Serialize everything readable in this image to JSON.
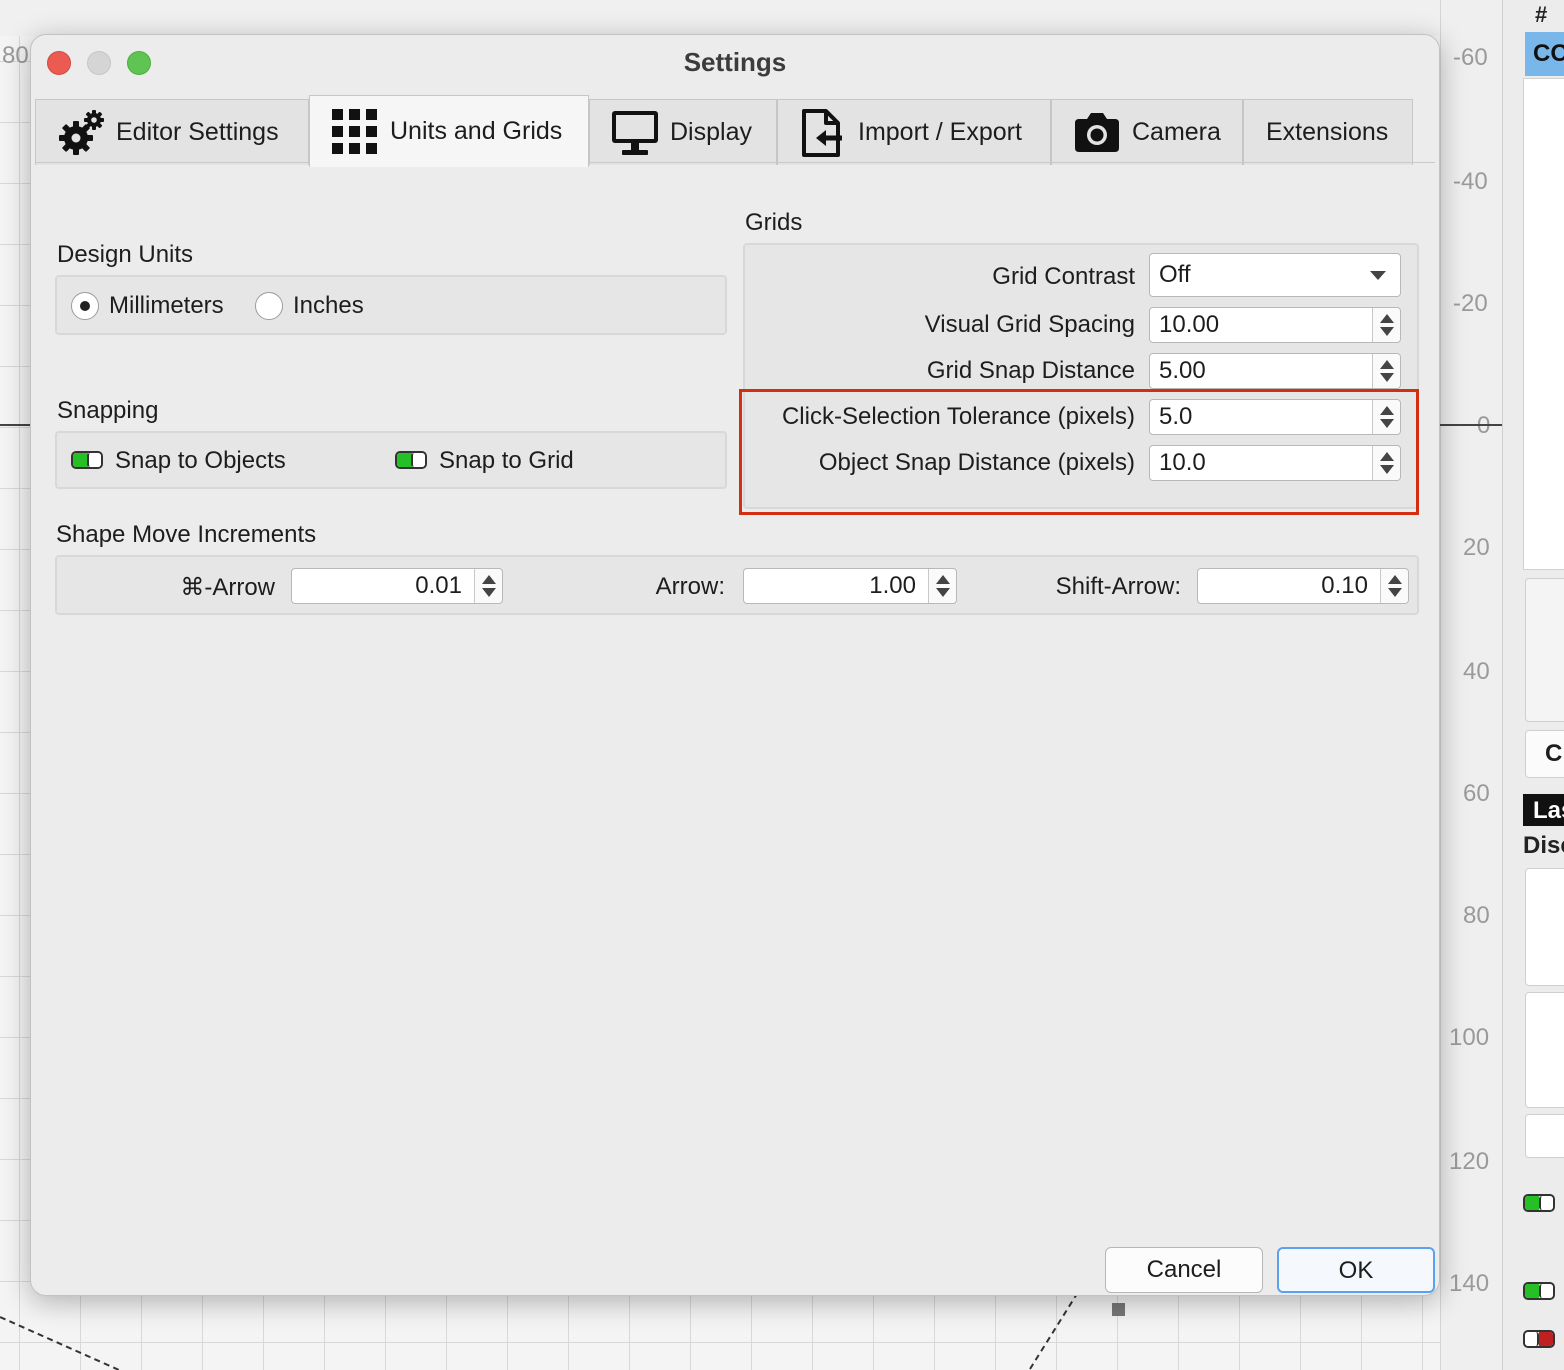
{
  "window": {
    "title": "Settings"
  },
  "tabs": [
    {
      "label": "Editor Settings",
      "icon": "gear-icon"
    },
    {
      "label": "Units and Grids",
      "icon": "grid-icon",
      "active": true
    },
    {
      "label": "Display",
      "icon": "monitor-icon"
    },
    {
      "label": "Import / Export",
      "icon": "import-export-icon"
    },
    {
      "label": "Camera",
      "icon": "camera-icon"
    },
    {
      "label": "Extensions",
      "icon": ""
    }
  ],
  "design_units": {
    "title": "Design Units",
    "options": [
      "Millimeters",
      "Inches"
    ],
    "selected": "Millimeters"
  },
  "snapping": {
    "title": "Snapping",
    "snap_to_objects": {
      "label": "Snap to Objects",
      "enabled": true
    },
    "snap_to_grid": {
      "label": "Snap to Grid",
      "enabled": true
    }
  },
  "grids": {
    "title": "Grids",
    "grid_contrast": {
      "label": "Grid Contrast",
      "value": "Off"
    },
    "visual_grid_spacing": {
      "label": "Visual Grid Spacing",
      "value": "10.00"
    },
    "grid_snap_distance": {
      "label": "Grid Snap Distance",
      "value": "5.00"
    },
    "click_selection_tolerance": {
      "label": "Click-Selection Tolerance (pixels)",
      "value": "5.0"
    },
    "object_snap_distance": {
      "label": "Object Snap Distance (pixels)",
      "value": "10.0"
    }
  },
  "shape_move_increments": {
    "title": "Shape Move Increments",
    "cmd_arrow": {
      "label": "⌘-Arrow",
      "value": "0.01"
    },
    "arrow": {
      "label": "Arrow:",
      "value": "1.00"
    },
    "shift_arrow": {
      "label": "Shift-Arrow:",
      "value": "0.10"
    }
  },
  "buttons": {
    "cancel": "Cancel",
    "ok": "OK"
  },
  "background": {
    "ruler_labels": [
      "-60",
      "-40",
      "-20",
      "0",
      "20",
      "40",
      "60",
      "80",
      "100",
      "120",
      "140"
    ],
    "left_ruler_label": "80",
    "side_panel": {
      "hash": "#",
      "selected_text": "CO",
      "button_text": "C",
      "black_label": "Las",
      "section_label": "Disc"
    }
  },
  "colors": {
    "highlight": "#d42e12",
    "toggle_on": "#25c025",
    "selection_blue": "#79b6ea",
    "close": "#ec5b52",
    "zoom": "#5fc451"
  }
}
